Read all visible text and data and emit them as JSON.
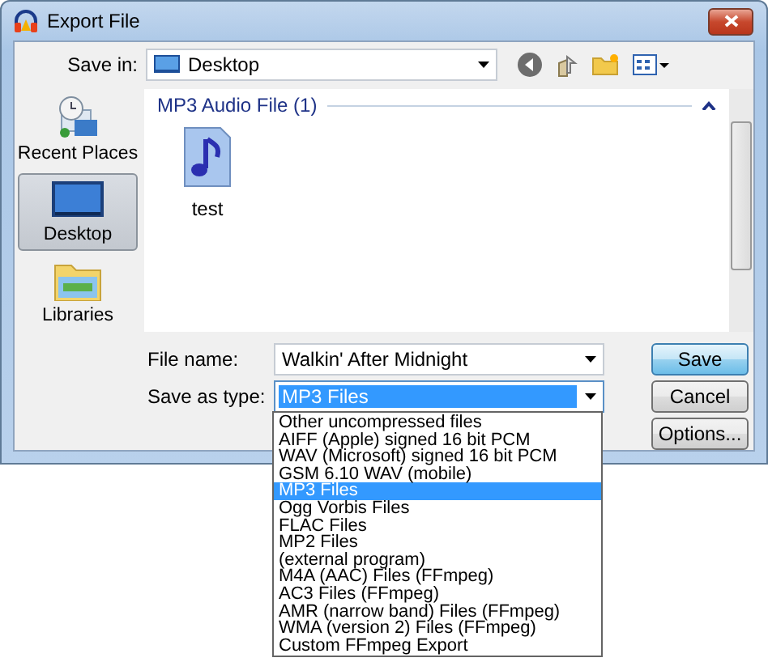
{
  "window": {
    "title": "Export File"
  },
  "save_in": {
    "label": "Save in:",
    "value": "Desktop"
  },
  "places": [
    {
      "kind": "recent",
      "label": "Recent Places",
      "selected": false
    },
    {
      "kind": "desktop",
      "label": "Desktop",
      "selected": true
    },
    {
      "kind": "libraries",
      "label": "Libraries",
      "selected": false
    }
  ],
  "file_group": {
    "header": "MP3 Audio File (1)",
    "expanded": true,
    "files": [
      {
        "name": "test"
      }
    ]
  },
  "file_name": {
    "label": "File name:",
    "value": "Walkin' After Midnight"
  },
  "save_as_type": {
    "label": "Save as type:",
    "value": "MP3 Files",
    "expanded": true,
    "options": [
      {
        "label": "Other uncompressed files",
        "selected": false
      },
      {
        "label": "AIFF (Apple) signed 16 bit PCM",
        "selected": false
      },
      {
        "label": "WAV (Microsoft) signed 16 bit PCM",
        "selected": false
      },
      {
        "label": "GSM 6.10 WAV (mobile)",
        "selected": false
      },
      {
        "label": "MP3 Files",
        "selected": true
      },
      {
        "label": "Ogg Vorbis Files",
        "selected": false
      },
      {
        "label": "FLAC Files",
        "selected": false
      },
      {
        "label": "MP2 Files",
        "selected": false
      },
      {
        "label": "(external program)",
        "selected": false
      },
      {
        "label": "M4A (AAC) Files (FFmpeg)",
        "selected": false
      },
      {
        "label": "AC3 Files (FFmpeg)",
        "selected": false
      },
      {
        "label": "AMR (narrow band) Files (FFmpeg)",
        "selected": false
      },
      {
        "label": "WMA (version 2) Files (FFmpeg)",
        "selected": false
      },
      {
        "label": "Custom FFmpeg Export",
        "selected": false
      }
    ]
  },
  "buttons": [
    {
      "label": "Save",
      "default": true
    },
    {
      "label": "Cancel",
      "default": false
    },
    {
      "label": "Options...",
      "default": false
    }
  ]
}
